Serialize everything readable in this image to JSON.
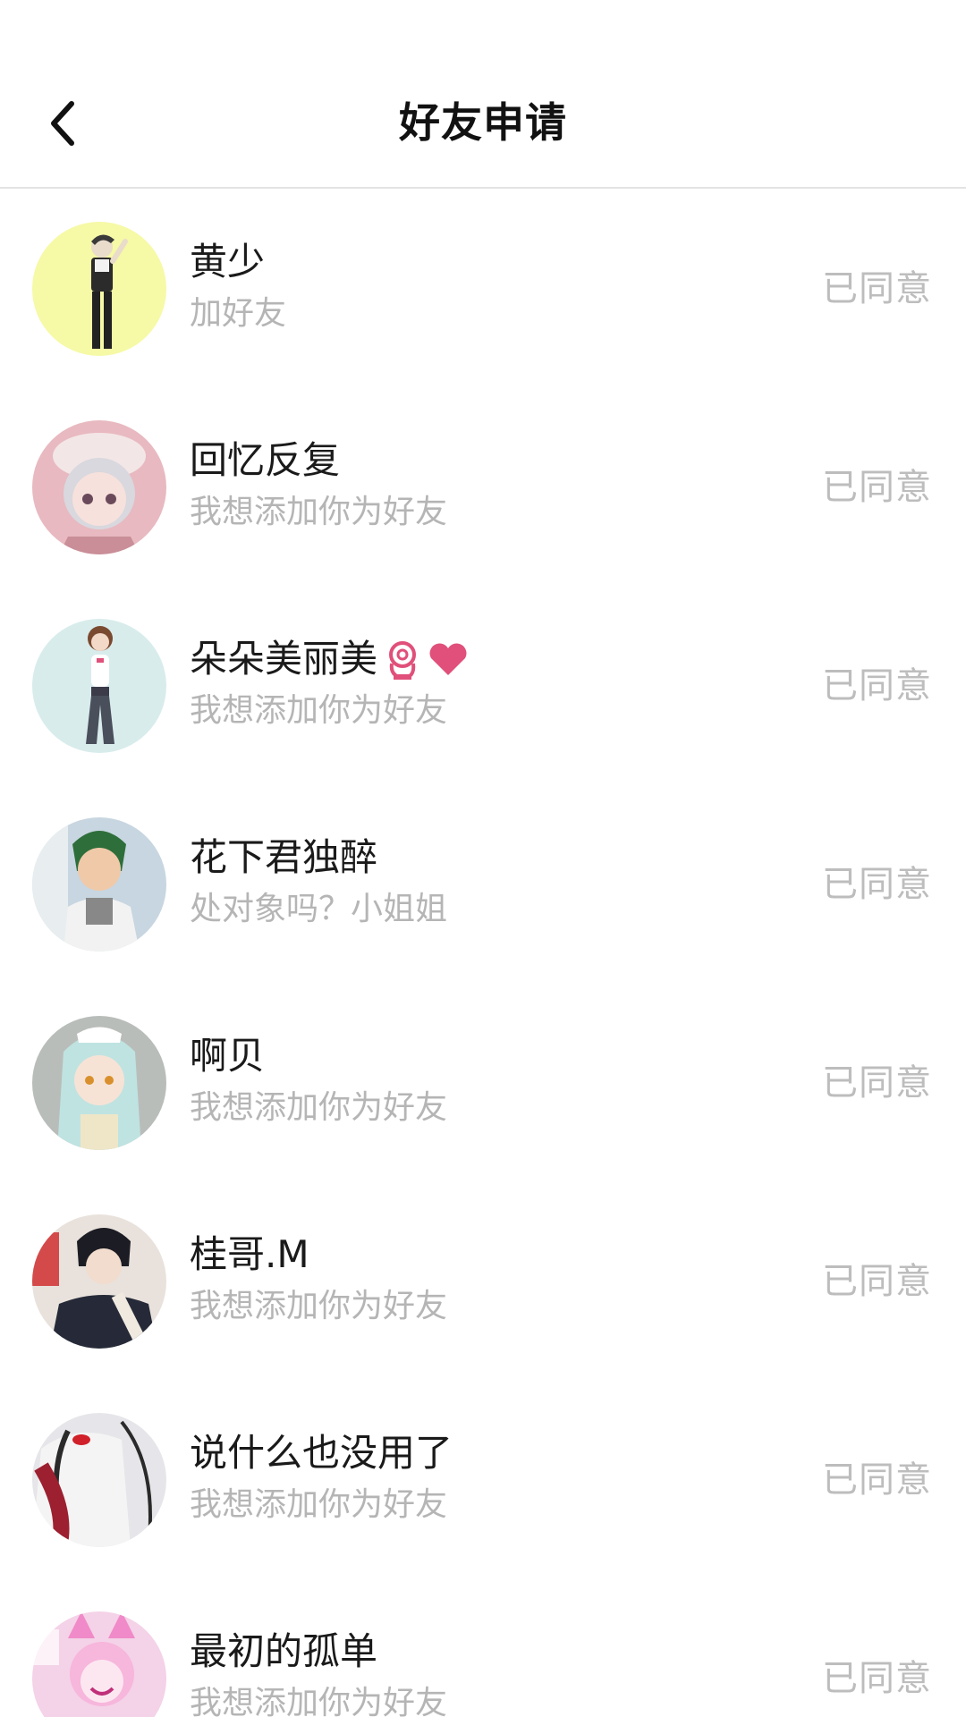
{
  "header": {
    "title": "好友申请"
  },
  "requests": [
    {
      "name": "黄少",
      "message": "加好友",
      "status": "已同意",
      "avatar_bg": "#f6f9a6"
    },
    {
      "name": "回忆反复",
      "message": "我想添加你为好友",
      "status": "已同意",
      "avatar_bg": "#e8b9c0"
    },
    {
      "name": "朵朵美丽美",
      "message": "我想添加你为好友",
      "status": "已同意",
      "avatar_bg": "#d9ecec"
    },
    {
      "name": "花下君独醉",
      "message": "处对象吗？小姐姐",
      "status": "已同意",
      "avatar_bg": "#c7d6e0"
    },
    {
      "name": "啊贝",
      "message": "我想添加你为好友",
      "status": "已同意",
      "avatar_bg": "#b9bdba"
    },
    {
      "name": "桂哥.M",
      "message": "我想添加你为好友",
      "status": "已同意",
      "avatar_bg": "#e9e2dc"
    },
    {
      "name": "说什么也没用了",
      "message": "我想添加你为好友",
      "status": "已同意",
      "avatar_bg": "#d9d9d9"
    },
    {
      "name": "最初的孤单",
      "message": "我想添加你为好友",
      "status": "已同意",
      "avatar_bg": "#f4d2e8"
    }
  ],
  "colors": {
    "name_text": "#1a1a1a",
    "message_text": "#b5b5b5",
    "status_text": "#bdbdbd",
    "emoji_accent": "#e0507a"
  },
  "icons": {
    "back": "chevron-left-icon",
    "hand": "ok-hand-icon",
    "heart": "heart-icon"
  }
}
